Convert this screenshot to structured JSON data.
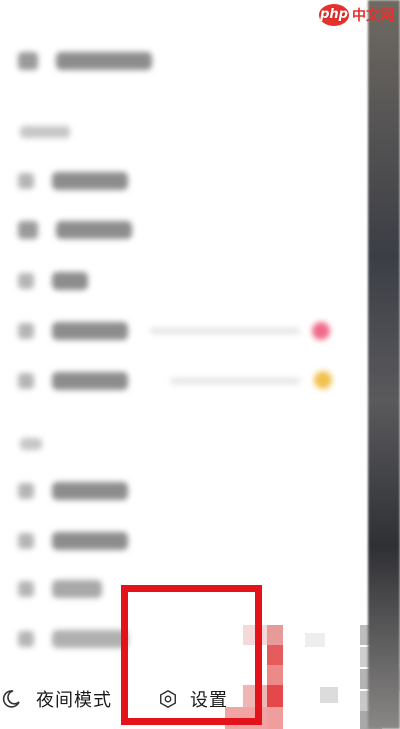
{
  "watermark": {
    "badge": "php",
    "site": "中文网"
  },
  "drawer": {
    "bottom_actions": [
      {
        "label": "夜间模式",
        "icon": "moon-icon"
      },
      {
        "label": "设置",
        "icon": "settings-gear-icon"
      }
    ]
  },
  "annotation": {
    "highlight_color": "#e3121b"
  },
  "colors": {
    "accent": "#e3121b",
    "badge_pink": "#f06a8a",
    "badge_yellow": "#f2c14e"
  }
}
